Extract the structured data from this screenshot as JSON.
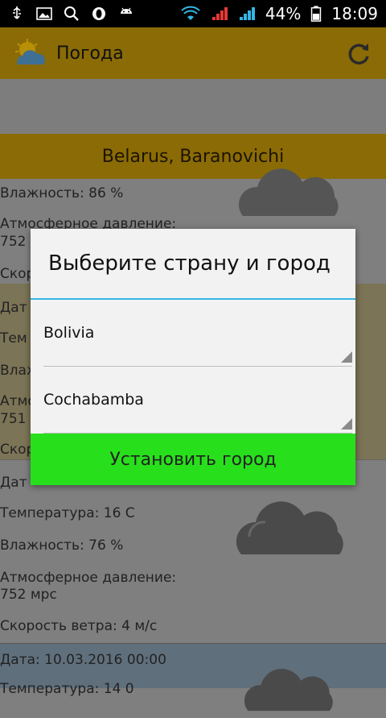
{
  "status_bar": {
    "battery": "44%",
    "time": "18:09",
    "icons": [
      "usb-icon",
      "image-icon",
      "search-icon",
      "opera-icon",
      "android-icon",
      "wifi-icon",
      "signal-icon",
      "signal-icon",
      "battery-icon"
    ]
  },
  "action_bar": {
    "title": "Погода",
    "icon": "weather-cloud-sun-icon",
    "refresh_icon": "refresh-icon"
  },
  "city": "Belarus, Baranovichi",
  "weather": [
    {
      "humidity": "Влажность: 86 %",
      "pressure_label": "Атмосферное давление:",
      "pressure_value": "752",
      "wind_partial": "Скор"
    },
    {
      "date_partial": "Дат",
      "temp_partial": "Тем",
      "humidity_partial": "Влаж",
      "pressure_partial": "Атмо",
      "pressure_value": "751",
      "wind_partial": "Скор"
    },
    {
      "date_partial": "Дат",
      "temperature": "Температура: 16 C",
      "humidity": "Влажность: 76 %",
      "pressure_label": "Атмосферное давление:",
      "pressure_value": "752 мрс",
      "wind": "Скорость ветра: 4 м/с"
    },
    {
      "date": "Дата: 10.03.2016 00:00",
      "temperature_partial": "Температура: 14 0"
    }
  ],
  "dialog": {
    "title": "Выберите страну и город",
    "country": "Bolivia",
    "city": "Cochabamba",
    "button": "Установить город"
  },
  "colors": {
    "accent": "#33b5e5",
    "button": "#27e01b",
    "bar": "#f4c20d"
  }
}
